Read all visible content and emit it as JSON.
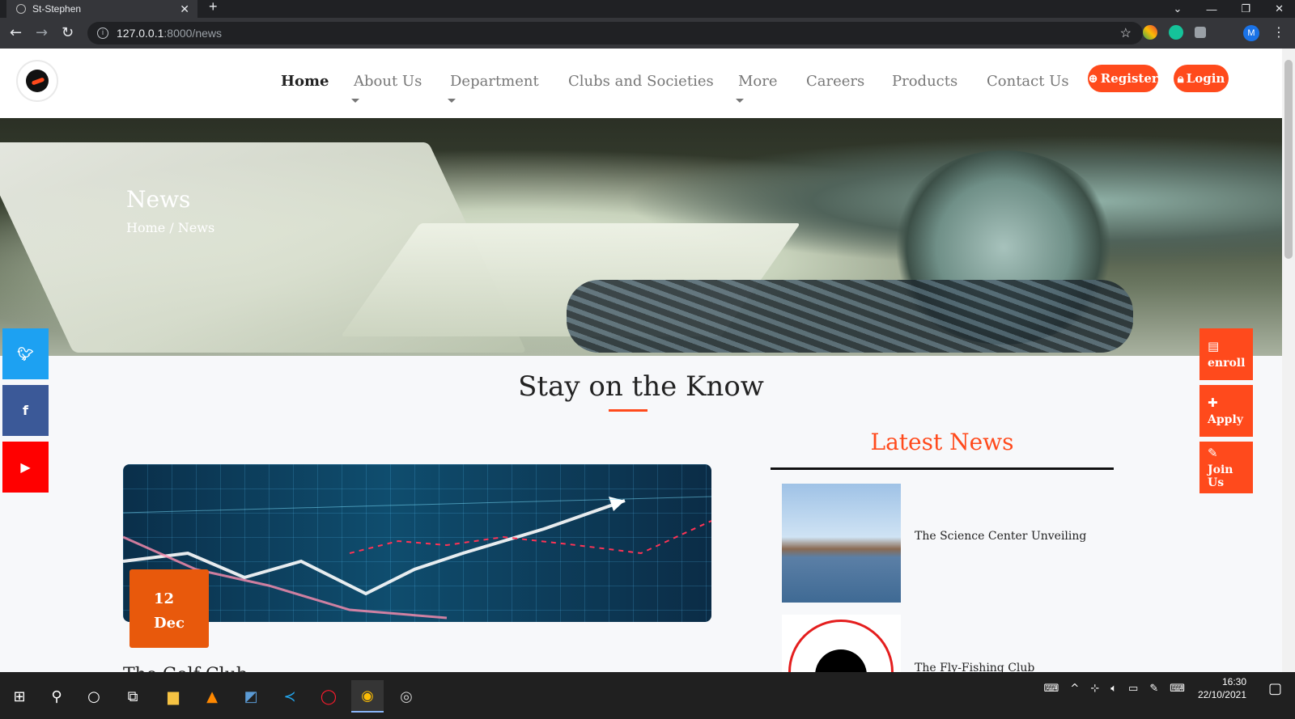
{
  "browser": {
    "tab_title": "St-Stephen",
    "url_host": "127.0.0.1",
    "url_path": ":8000/news",
    "profile_initial": "M"
  },
  "nav": {
    "items": [
      "Home",
      "About Us",
      "Department",
      "Clubs and Societies",
      "More",
      "Careers",
      "Products",
      "Contact Us"
    ],
    "register_label": "Register",
    "login_label": "Login"
  },
  "hero": {
    "title": "News",
    "breadcrumb": "Home / News"
  },
  "side_actions": [
    "enroll",
    "Apply",
    "Join Us"
  ],
  "main": {
    "section_title": "Stay on the Know",
    "post": {
      "day": "12",
      "month": "Dec",
      "title": "The Golf Club"
    }
  },
  "latest": {
    "title": "Latest News",
    "items": [
      "The Science Center Unveiling",
      "The Fly-Fishing Club"
    ]
  },
  "taskbar": {
    "time": "16:30",
    "date": "22/10/2021"
  },
  "colors": {
    "accent": "#ff4a1c",
    "badge": "#e8590c",
    "twitter": "#1da1f2",
    "facebook": "#3b5998",
    "youtube": "#ff0000"
  },
  "icons": [
    "globe-icon",
    "back-icon",
    "forward-icon",
    "reload-icon",
    "star-icon",
    "twitter-icon",
    "facebook-icon",
    "youtube-icon",
    "file-icon",
    "plus-icon",
    "edit-icon",
    "windows-icon",
    "search-icon"
  ]
}
